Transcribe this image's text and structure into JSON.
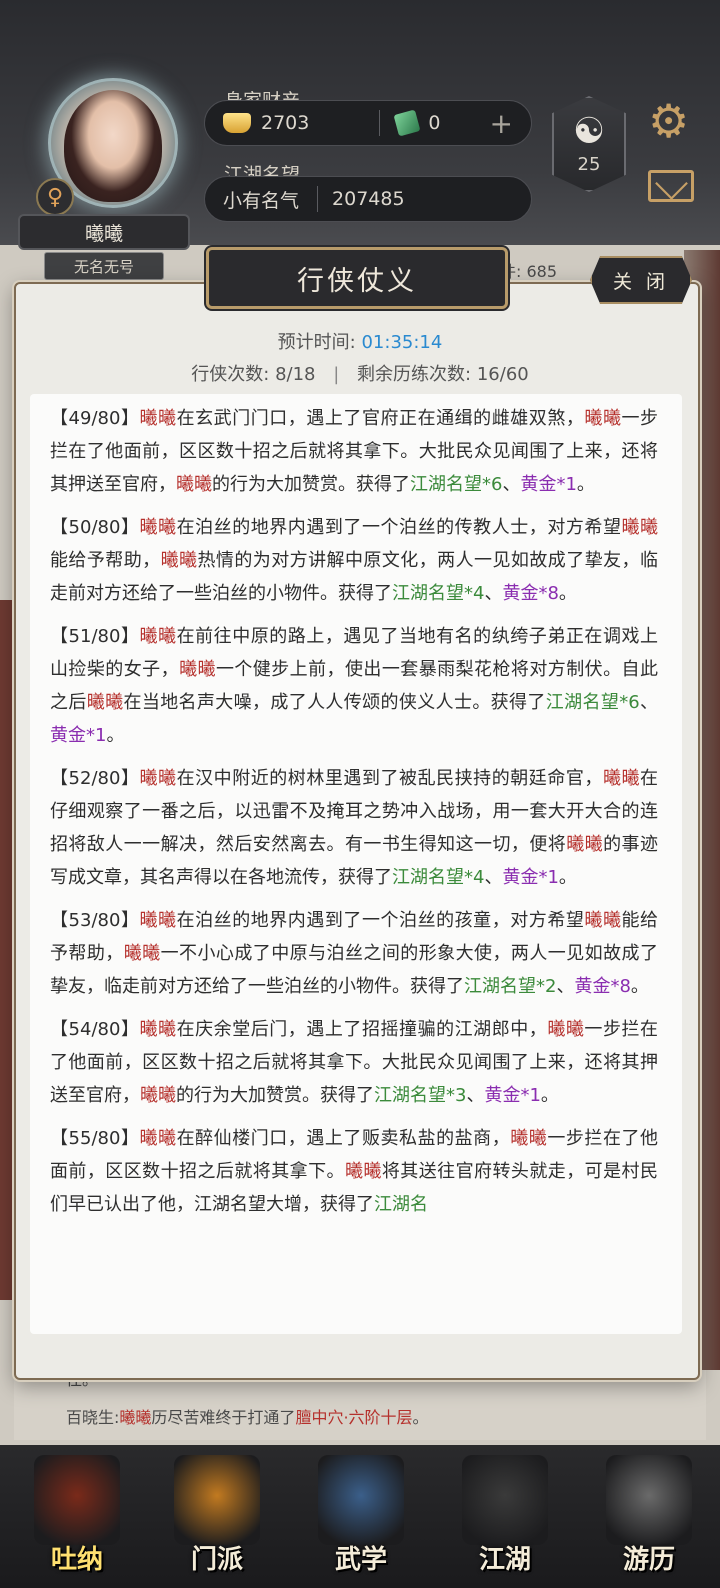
{
  "header": {
    "character_name": "曦曦",
    "character_title": "无名无号",
    "gender_symbol": "♀",
    "wealth_label": "身家财产",
    "gold_amount": "2703",
    "jade_amount": "0",
    "plus_symbol": "+",
    "reputation_label": "江湖名望",
    "reputation_rank": "小有名气",
    "reputation_value": "207485",
    "level_symbol": "☯",
    "level": "25",
    "gear_symbol": "⚙"
  },
  "background": {
    "peek_text": "件: 685",
    "log_line1": "往。",
    "log_prefix": "百晓生:",
    "log_name": "曦曦",
    "log_mid": "历尽苦难终于打通了",
    "log_highlight": "膻中穴·六阶十层",
    "log_end": "。"
  },
  "modal": {
    "title": "行侠仗义",
    "close_label": "关 闭",
    "estimated_time_label": "预计时间:",
    "estimated_time_value": "01:35:14",
    "xiaxia_count_label": "行侠次数:",
    "xiaxia_count_value": "8/18",
    "separator": "|",
    "remaining_label": "剩余历练次数:",
    "remaining_value": "16/60"
  },
  "log_entries": [
    {
      "parts": [
        {
          "t": "【49/80】",
          "c": "n"
        },
        {
          "t": "曦曦",
          "c": "r"
        },
        {
          "t": "在玄武门门口，遇上了官府正在通缉的雌雄双煞，",
          "c": "n"
        },
        {
          "t": "曦曦",
          "c": "r"
        },
        {
          "t": "一步拦在了他面前，区区数十招之后就将其拿下。大批民众见闻围了上来，还将其押送至官府，",
          "c": "n"
        },
        {
          "t": "曦曦",
          "c": "r"
        },
        {
          "t": "的行为大加赞赏。获得了",
          "c": "n"
        },
        {
          "t": "江湖名望*6",
          "c": "g"
        },
        {
          "t": "、",
          "c": "n"
        },
        {
          "t": "黄金*1",
          "c": "p"
        },
        {
          "t": "。",
          "c": "n"
        }
      ]
    },
    {
      "parts": [
        {
          "t": "【50/80】",
          "c": "n"
        },
        {
          "t": "曦曦",
          "c": "r"
        },
        {
          "t": "在泊丝的地界内遇到了一个泊丝的传教人士，对方希望",
          "c": "n"
        },
        {
          "t": "曦曦",
          "c": "r"
        },
        {
          "t": "能给予帮助，",
          "c": "n"
        },
        {
          "t": "曦曦",
          "c": "r"
        },
        {
          "t": "热情的为对方讲解中原文化，两人一见如故成了挚友，临走前对方还给了一些泊丝的小物件。获得了",
          "c": "n"
        },
        {
          "t": "江湖名望*4",
          "c": "g"
        },
        {
          "t": "、",
          "c": "n"
        },
        {
          "t": "黄金*8",
          "c": "p"
        },
        {
          "t": "。",
          "c": "n"
        }
      ]
    },
    {
      "parts": [
        {
          "t": "【51/80】",
          "c": "n"
        },
        {
          "t": "曦曦",
          "c": "r"
        },
        {
          "t": "在前往中原的路上，遇见了当地有名的纨绔子弟正在调戏上山捡柴的女子，",
          "c": "n"
        },
        {
          "t": "曦曦",
          "c": "r"
        },
        {
          "t": "一个健步上前，使出一套暴雨梨花枪将对方制伏。自此之后",
          "c": "n"
        },
        {
          "t": "曦曦",
          "c": "r"
        },
        {
          "t": "在当地名声大噪，成了人人传颂的侠义人士。获得了",
          "c": "n"
        },
        {
          "t": "江湖名望*6",
          "c": "g"
        },
        {
          "t": "、",
          "c": "n"
        },
        {
          "t": "黄金*1",
          "c": "p"
        },
        {
          "t": "。",
          "c": "n"
        }
      ]
    },
    {
      "parts": [
        {
          "t": "【52/80】",
          "c": "n"
        },
        {
          "t": "曦曦",
          "c": "r"
        },
        {
          "t": "在汉中附近的树林里遇到了被乱民挟持的朝廷命官，",
          "c": "n"
        },
        {
          "t": "曦曦",
          "c": "r"
        },
        {
          "t": "在仔细观察了一番之后，以迅雷不及掩耳之势冲入战场，用一套大开大合的连招将敌人一一解决，然后安然离去。有一书生得知这一切，便将",
          "c": "n"
        },
        {
          "t": "曦曦",
          "c": "r"
        },
        {
          "t": "的事迹写成文章，其名声得以在各地流传，获得了",
          "c": "n"
        },
        {
          "t": "江湖名望*4",
          "c": "g"
        },
        {
          "t": "、",
          "c": "n"
        },
        {
          "t": "黄金*1",
          "c": "p"
        },
        {
          "t": "。",
          "c": "n"
        }
      ]
    },
    {
      "parts": [
        {
          "t": "【53/80】",
          "c": "n"
        },
        {
          "t": "曦曦",
          "c": "r"
        },
        {
          "t": "在泊丝的地界内遇到了一个泊丝的孩童，对方希望",
          "c": "n"
        },
        {
          "t": "曦曦",
          "c": "r"
        },
        {
          "t": "能给予帮助，",
          "c": "n"
        },
        {
          "t": "曦曦",
          "c": "r"
        },
        {
          "t": "一不小心成了中原与泊丝之间的形象大使，两人一见如故成了挚友，临走前对方还给了一些泊丝的小物件。获得了",
          "c": "n"
        },
        {
          "t": "江湖名望*2",
          "c": "g"
        },
        {
          "t": "、",
          "c": "n"
        },
        {
          "t": "黄金*8",
          "c": "p"
        },
        {
          "t": "。",
          "c": "n"
        }
      ]
    },
    {
      "parts": [
        {
          "t": "【54/80】",
          "c": "n"
        },
        {
          "t": "曦曦",
          "c": "r"
        },
        {
          "t": "在庆余堂后门，遇上了招摇撞骗的江湖郎中，",
          "c": "n"
        },
        {
          "t": "曦曦",
          "c": "r"
        },
        {
          "t": "一步拦在了他面前，区区数十招之后就将其拿下。大批民众见闻围了上来，还将其押送至官府，",
          "c": "n"
        },
        {
          "t": "曦曦",
          "c": "r"
        },
        {
          "t": "的行为大加赞赏。获得了",
          "c": "n"
        },
        {
          "t": "江湖名望*3",
          "c": "g"
        },
        {
          "t": "、",
          "c": "n"
        },
        {
          "t": "黄金*1",
          "c": "p"
        },
        {
          "t": "。",
          "c": "n"
        }
      ]
    },
    {
      "parts": [
        {
          "t": "【55/80】",
          "c": "n"
        },
        {
          "t": "曦曦",
          "c": "r"
        },
        {
          "t": "在醉仙楼门口，遇上了贩卖私盐的盐商，",
          "c": "n"
        },
        {
          "t": "曦曦",
          "c": "r"
        },
        {
          "t": "一步拦在了他面前，区区数十招之后就将其拿下。",
          "c": "n"
        },
        {
          "t": "曦曦",
          "c": "r"
        },
        {
          "t": "将其送往官府转头就走，可是村民们早已认出了他，江湖名望大增，获得了",
          "c": "n"
        },
        {
          "t": "江湖名",
          "c": "g"
        }
      ]
    }
  ],
  "bottom_nav": [
    {
      "label": "吐纳",
      "icon": "tuna-icon",
      "color": "#7a2a1a",
      "active": true
    },
    {
      "label": "门派",
      "icon": "sect-banner-icon",
      "color": "#c27a20",
      "active": false
    },
    {
      "label": "武学",
      "icon": "scroll-books-icon",
      "color": "#3b5f8a",
      "active": false
    },
    {
      "label": "江湖",
      "icon": "jianghu-hat-icon",
      "color": "#3a3a3a",
      "active": false
    },
    {
      "label": "游历",
      "icon": "horse-icon",
      "color": "#6a6a6a",
      "active": false
    }
  ],
  "colors": {
    "name_red": "#b5302c",
    "reward_green": "#3b8a3b",
    "reward_purple": "#8a2db0",
    "time_blue": "#2a8ad0",
    "gold_accent": "#c7a066"
  }
}
